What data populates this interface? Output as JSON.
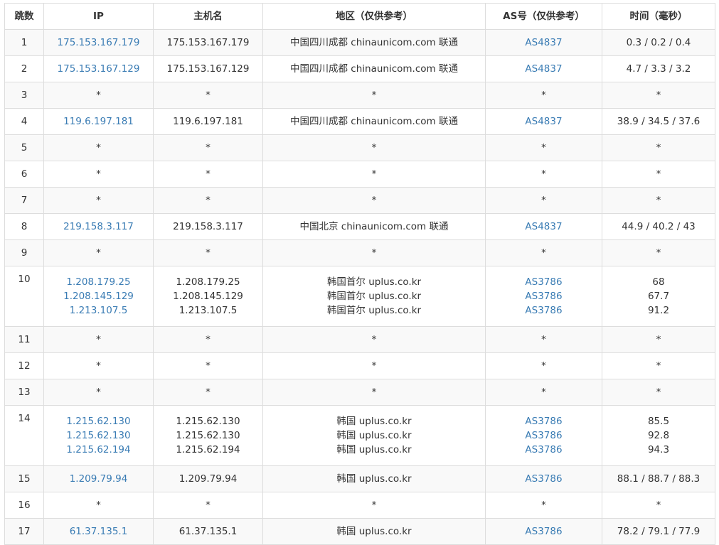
{
  "headers": {
    "hop": "跳数",
    "ip": "IP",
    "hostname": "主机名",
    "region": "地区（仅供参考）",
    "as": "AS号（仅供参考）",
    "time": "时间（毫秒）"
  },
  "colors": {
    "link": "#3a7cb4",
    "stripe": "#f9f9f9",
    "border": "#dddddd"
  },
  "rows": [
    {
      "hop": "1",
      "lines": [
        {
          "ip": "175.153.167.179",
          "host": "175.153.167.179",
          "region": "中国四川成都 chinaunicom.com 联通",
          "as": "AS4837",
          "time": "0.3 / 0.2 / 0.4"
        }
      ]
    },
    {
      "hop": "2",
      "lines": [
        {
          "ip": "175.153.167.129",
          "host": "175.153.167.129",
          "region": "中国四川成都 chinaunicom.com 联通",
          "as": "AS4837",
          "time": "4.7 / 3.3 / 3.2"
        }
      ]
    },
    {
      "hop": "3",
      "lines": [
        {
          "ip": "*",
          "host": "*",
          "region": "*",
          "as": "*",
          "time": "*"
        }
      ]
    },
    {
      "hop": "4",
      "lines": [
        {
          "ip": "119.6.197.181",
          "host": "119.6.197.181",
          "region": "中国四川成都 chinaunicom.com 联通",
          "as": "AS4837",
          "time": "38.9 / 34.5 / 37.6"
        }
      ]
    },
    {
      "hop": "5",
      "lines": [
        {
          "ip": "*",
          "host": "*",
          "region": "*",
          "as": "*",
          "time": "*"
        }
      ]
    },
    {
      "hop": "6",
      "lines": [
        {
          "ip": "*",
          "host": "*",
          "region": "*",
          "as": "*",
          "time": "*"
        }
      ]
    },
    {
      "hop": "7",
      "lines": [
        {
          "ip": "*",
          "host": "*",
          "region": "*",
          "as": "*",
          "time": "*"
        }
      ]
    },
    {
      "hop": "8",
      "lines": [
        {
          "ip": "219.158.3.117",
          "host": "219.158.3.117",
          "region": "中国北京 chinaunicom.com 联通",
          "as": "AS4837",
          "time": "44.9 / 40.2 / 43"
        }
      ]
    },
    {
      "hop": "9",
      "lines": [
        {
          "ip": "*",
          "host": "*",
          "region": "*",
          "as": "*",
          "time": "*"
        }
      ]
    },
    {
      "hop": "10",
      "lines": [
        {
          "ip": "1.208.179.25",
          "host": "1.208.179.25",
          "region": "韩国首尔 uplus.co.kr",
          "as": "AS3786",
          "time": "68"
        },
        {
          "ip": "1.208.145.129",
          "host": "1.208.145.129",
          "region": "韩国首尔 uplus.co.kr",
          "as": "AS3786",
          "time": "67.7"
        },
        {
          "ip": "1.213.107.5",
          "host": "1.213.107.5",
          "region": "韩国首尔 uplus.co.kr",
          "as": "AS3786",
          "time": "91.2"
        }
      ]
    },
    {
      "hop": "11",
      "lines": [
        {
          "ip": "*",
          "host": "*",
          "region": "*",
          "as": "*",
          "time": "*"
        }
      ]
    },
    {
      "hop": "12",
      "lines": [
        {
          "ip": "*",
          "host": "*",
          "region": "*",
          "as": "*",
          "time": "*"
        }
      ]
    },
    {
      "hop": "13",
      "lines": [
        {
          "ip": "*",
          "host": "*",
          "region": "*",
          "as": "*",
          "time": "*"
        }
      ]
    },
    {
      "hop": "14",
      "lines": [
        {
          "ip": "1.215.62.130",
          "host": "1.215.62.130",
          "region": "韩国 uplus.co.kr",
          "as": "AS3786",
          "time": "85.5"
        },
        {
          "ip": "1.215.62.130",
          "host": "1.215.62.130",
          "region": "韩国 uplus.co.kr",
          "as": "AS3786",
          "time": "92.8"
        },
        {
          "ip": "1.215.62.194",
          "host": "1.215.62.194",
          "region": "韩国 uplus.co.kr",
          "as": "AS3786",
          "time": "94.3"
        }
      ]
    },
    {
      "hop": "15",
      "lines": [
        {
          "ip": "1.209.79.94",
          "host": "1.209.79.94",
          "region": "韩国 uplus.co.kr",
          "as": "AS3786",
          "time": "88.1 / 88.7 / 88.3"
        }
      ]
    },
    {
      "hop": "16",
      "lines": [
        {
          "ip": "*",
          "host": "*",
          "region": "*",
          "as": "*",
          "time": "*"
        }
      ]
    },
    {
      "hop": "17",
      "lines": [
        {
          "ip": "61.37.135.1",
          "host": "61.37.135.1",
          "region": "韩国 uplus.co.kr",
          "as": "AS3786",
          "time": "78.2 / 79.1 / 77.9"
        }
      ]
    }
  ]
}
